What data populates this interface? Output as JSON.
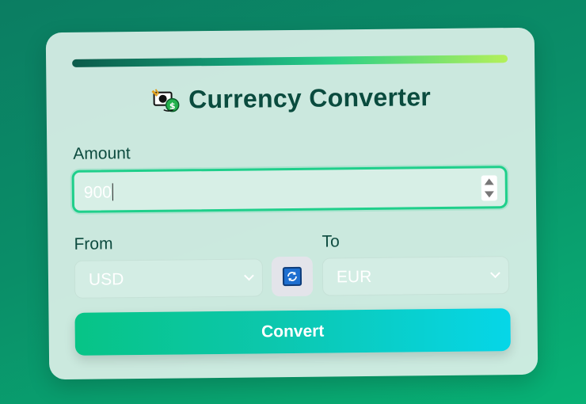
{
  "app": {
    "title": "Currency Converter",
    "title_icon": "currency-exchange-icon"
  },
  "amount": {
    "label": "Amount",
    "value": "900"
  },
  "from": {
    "label": "From",
    "selected": "USD"
  },
  "to": {
    "label": "To",
    "selected": "EUR"
  },
  "swap": {
    "icon": "swap-icon"
  },
  "convert": {
    "label": "Convert"
  },
  "colors": {
    "primary_text": "#0a4b3e",
    "accent_green": "#1fcf8b",
    "button_start": "#07c486",
    "button_end": "#06d6e8",
    "background": "#0a8e68"
  }
}
